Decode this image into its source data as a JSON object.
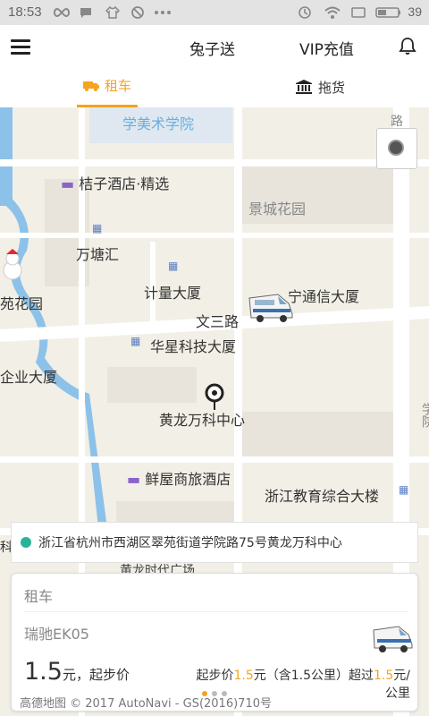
{
  "status_bar": {
    "time": "18:53",
    "battery": "39"
  },
  "header": {
    "title": "兔子送",
    "vip": "VIP充值"
  },
  "tabs": [
    {
      "label": "租车"
    },
    {
      "label": "拖货"
    }
  ],
  "map": {
    "labels": {
      "art_school": "学美术学院",
      "road_top": "路",
      "hotel_juzi": "桔子酒店·精选",
      "jingcheng": "景城花园",
      "wantang": "万塘汇",
      "jiliang": "计量大厦",
      "yuan_garden": "苑花园",
      "tongxin": "宁通信大厦",
      "wensan": "文三路",
      "huaxing": "华星科技大厦",
      "qiye": "企业大厦",
      "huanglong": "黄龙万科中心",
      "xuewu": "学院",
      "xianwu": "鲜屋商旅酒店",
      "jiaoyu": "浙江教育综合大楼",
      "left_ke": "科",
      "partial_bottom": "黄龙时代广场"
    }
  },
  "address": "浙江省杭州市西湖区翠苑街道学院路75号黄龙万科中心",
  "panel": {
    "title": "租车",
    "model": "瑞驰EK05",
    "price_num": "1.5",
    "price_unit": "元，起步价",
    "rule": {
      "p1": "起步价",
      "v1": "1.5",
      "p2": "元（含1.5公里）超过",
      "v2": "1.5",
      "p3": "元/",
      "p4": "公里"
    },
    "page_count": 3,
    "active_page": 0
  },
  "watermark": "高德地图 © 2017 AutoNavi - GS(2016)710号",
  "colors": {
    "accent": "#f5a41d",
    "address_dot": "#2bb39a"
  }
}
